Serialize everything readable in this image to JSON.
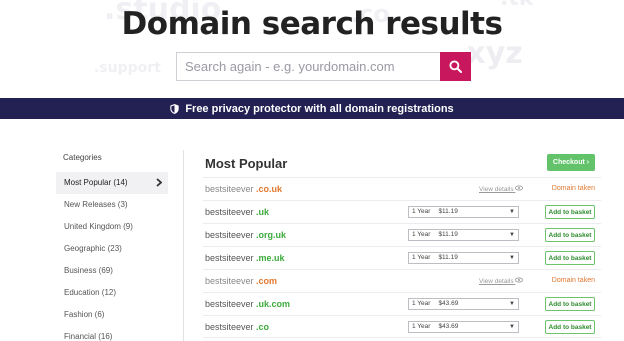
{
  "hero": {
    "background_words": [
      ".studio",
      ".support",
      ".xyz",
      ".co",
      ".tk"
    ],
    "title": "Domain search results",
    "search_placeholder": "Search again - e.g. yourdomain.com"
  },
  "banner": {
    "text": "Free privacy protector with all domain registrations"
  },
  "sidebar": {
    "title": "Categories",
    "items": [
      {
        "label": "Most Popular (14)"
      },
      {
        "label": "New Releases (3)"
      },
      {
        "label": "United Kingdom (9)"
      },
      {
        "label": "Geographic (23)"
      },
      {
        "label": "Business (69)"
      },
      {
        "label": "Education (12)"
      },
      {
        "label": "Fashion (6)"
      },
      {
        "label": "Financial (16)"
      }
    ]
  },
  "main": {
    "title": "Most Popular",
    "checkout_label": "Checkout ›",
    "rows": [
      {
        "name": "bestsiteever",
        "tld": ".co.uk",
        "status": "taken",
        "view_details": "View details",
        "taken_label": "Domain taken"
      },
      {
        "name": "bestsiteever",
        "tld": ".uk",
        "status": "available",
        "period": "1 Year",
        "price": "$11.19",
        "basket_label": "Add to basket"
      },
      {
        "name": "bestsiteever",
        "tld": ".org.uk",
        "status": "available",
        "period": "1 Year",
        "price": "$11.19",
        "basket_label": "Add to basket"
      },
      {
        "name": "bestsiteever",
        "tld": ".me.uk",
        "status": "available",
        "period": "1 Year",
        "price": "$11.19",
        "basket_label": "Add to basket"
      },
      {
        "name": "bestsiteever",
        "tld": ".com",
        "status": "taken",
        "view_details": "View details",
        "taken_label": "Domain taken"
      },
      {
        "name": "bestsiteever",
        "tld": ".uk.com",
        "status": "available",
        "period": "1 Year",
        "price": "$43.69",
        "basket_label": "Add to basket"
      },
      {
        "name": "bestsiteever",
        "tld": ".co",
        "status": "available",
        "period": "1 Year",
        "price": "$43.69",
        "basket_label": "Add to basket"
      }
    ]
  },
  "colors": {
    "accent": "#c8175c",
    "banner_bg": "#232154",
    "available_green": "#3daa3d",
    "taken_orange": "#e07830",
    "checkout_green": "#62c36a"
  }
}
